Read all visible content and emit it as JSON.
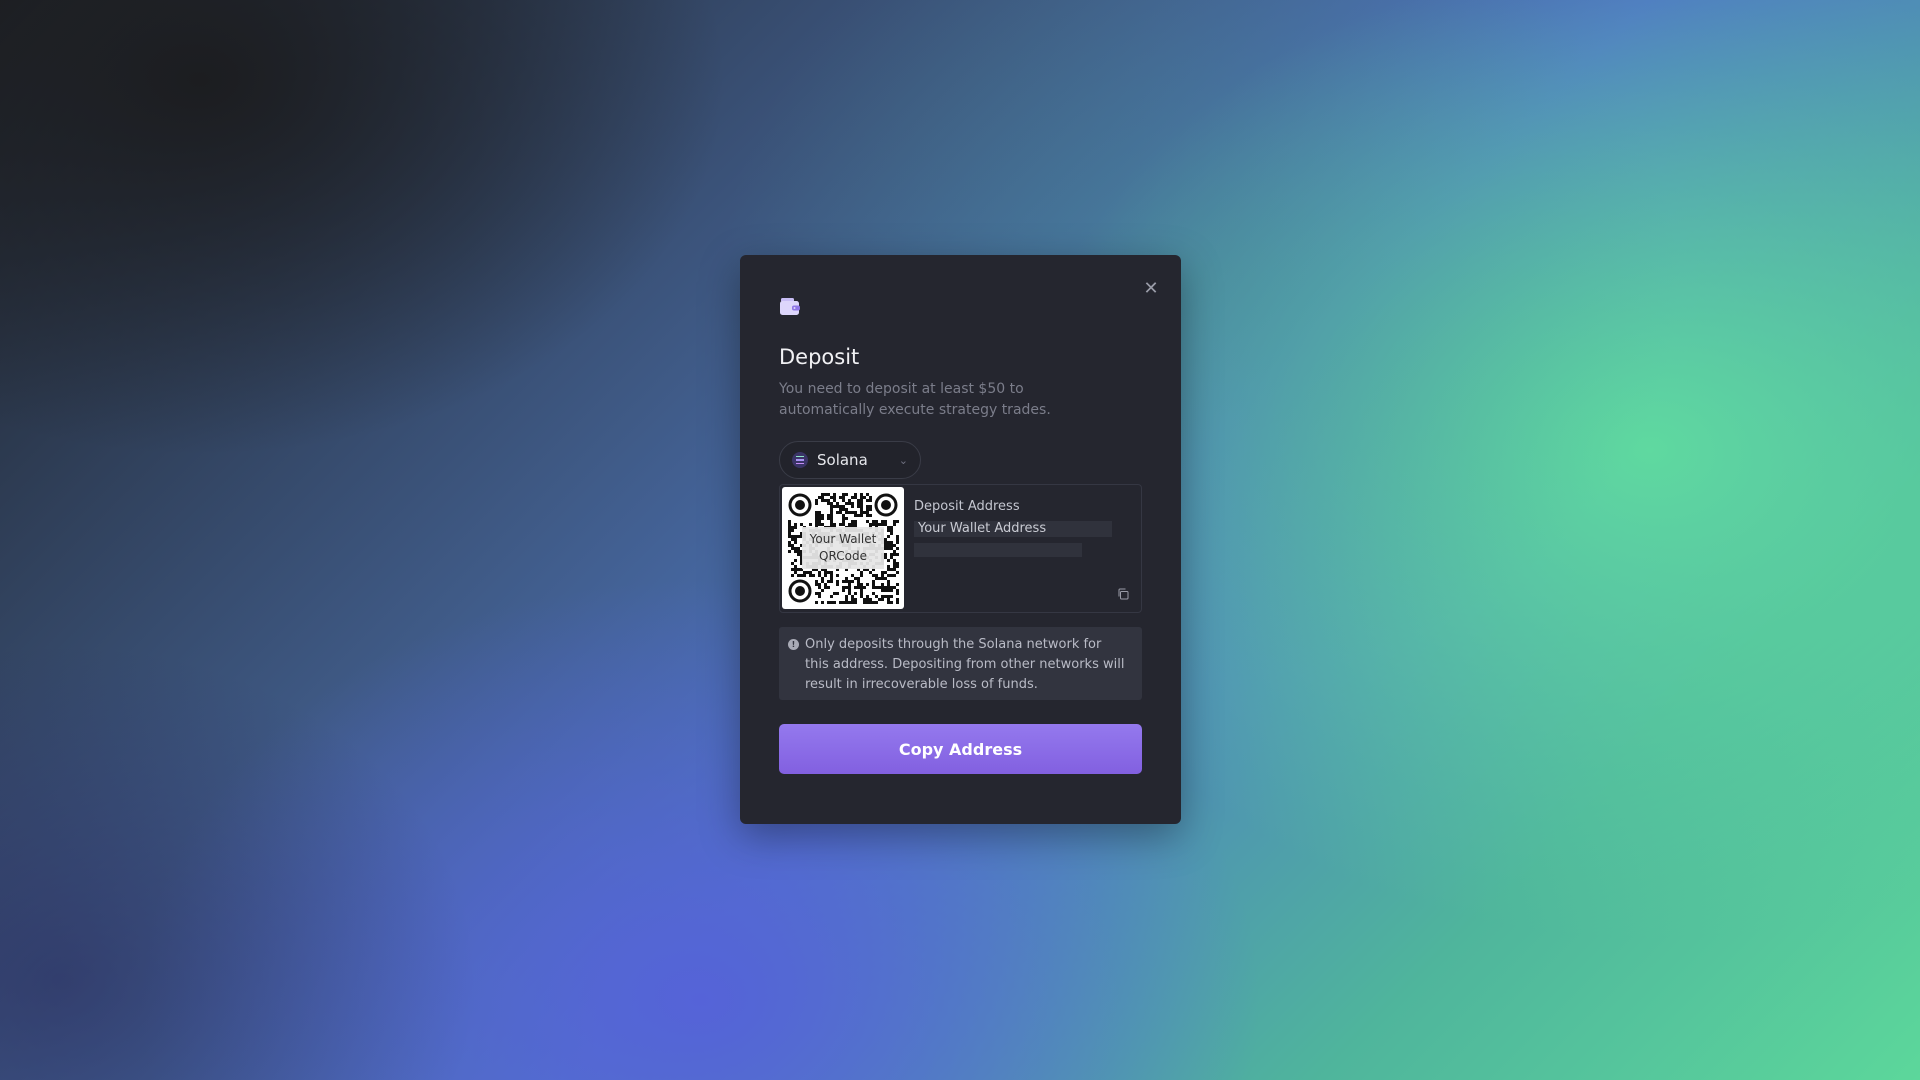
{
  "modal": {
    "close_icon": "close-icon",
    "header_icon": "wallet-icon",
    "title": "Deposit",
    "subtitle": "You need to deposit at least $50 to automatically execute strategy trades.",
    "network": {
      "icon": "solana-icon",
      "selected": "Solana",
      "chevron": "chevron-down-icon"
    },
    "qr": {
      "label_line1": "Your Wallet",
      "label_line2": "QRCode"
    },
    "address": {
      "heading": "Deposit Address",
      "value": "Your Wallet Address",
      "copy_icon": "copy-icon"
    },
    "notice": {
      "icon": "info-icon",
      "text": "Only deposits through the Solana network for this address. Depositing from other networks will result in irrecoverable loss of funds."
    },
    "copy_button_label": "Copy Address"
  },
  "colors": {
    "accent": "#8a6ae8",
    "modal_bg": "#25262f",
    "notice_bg": "#32343f"
  }
}
